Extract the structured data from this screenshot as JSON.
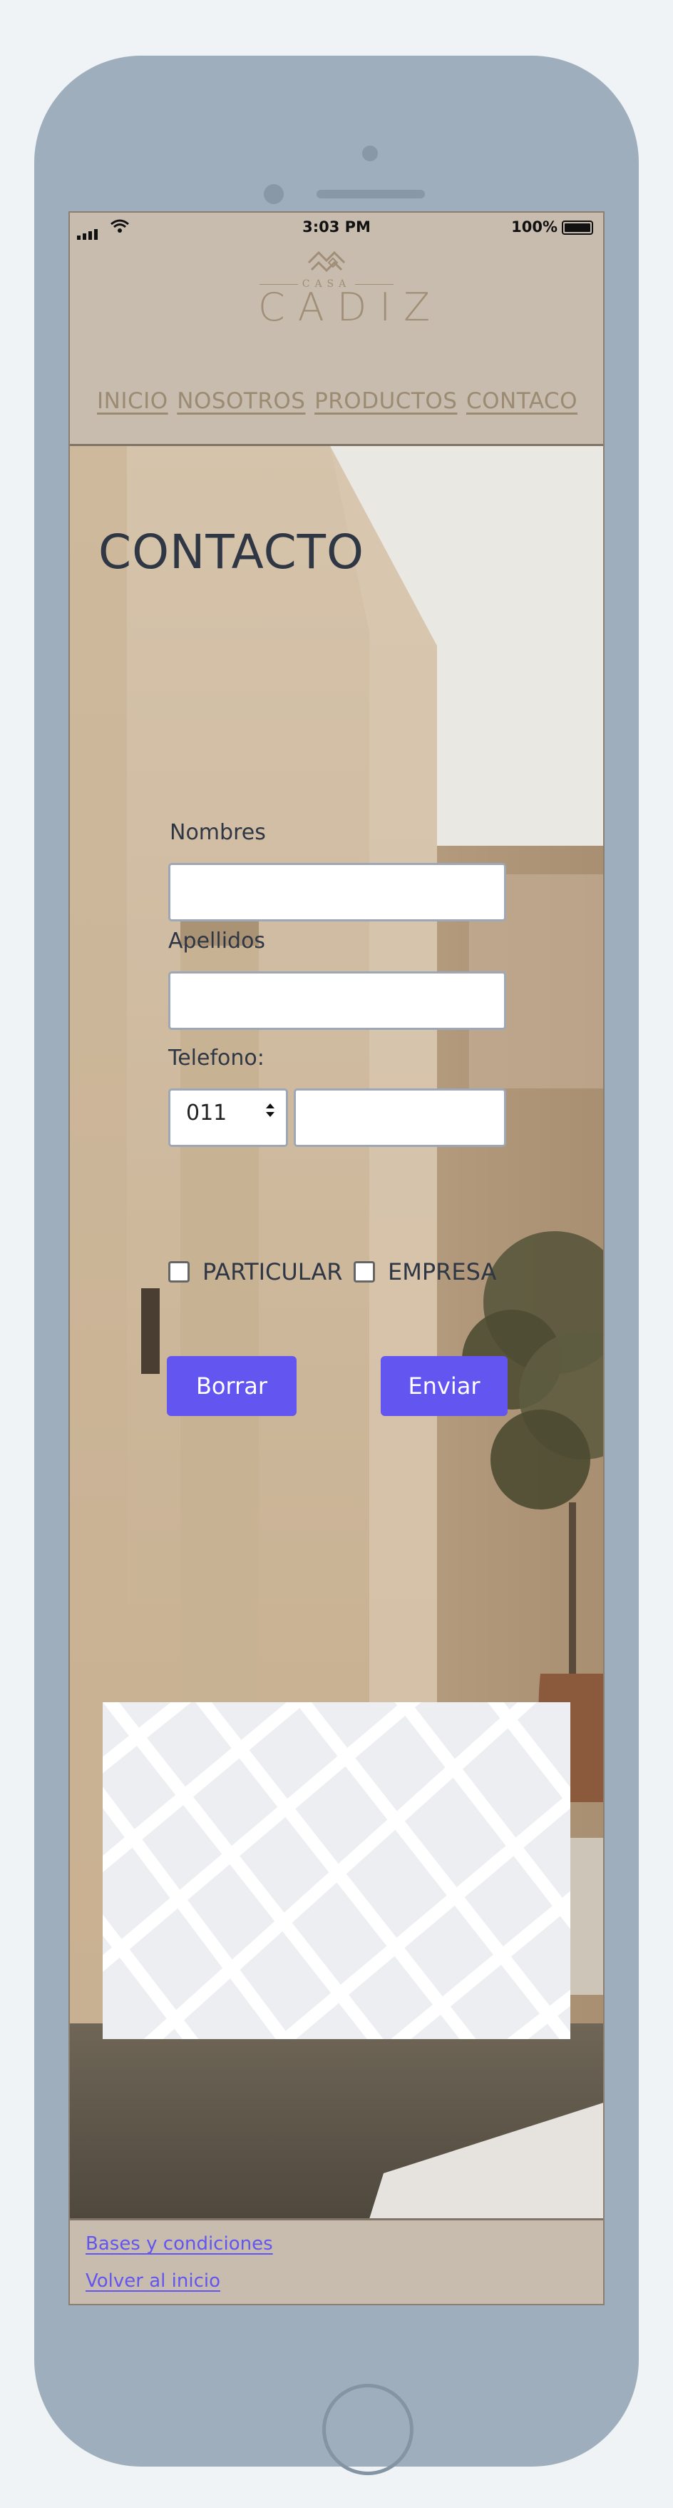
{
  "status_bar": {
    "time": "3:03 PM",
    "battery": "100%"
  },
  "brand": {
    "small": "CASA",
    "big": "CADIZ"
  },
  "nav": {
    "items": [
      "INICIO",
      "NOSOTROS",
      "PRODUCTOS",
      "CONTACO"
    ]
  },
  "page": {
    "title": "CONTACTO"
  },
  "form": {
    "first_name_label": "Nombres",
    "first_name_value": "",
    "last_name_label": "Apellidos",
    "last_name_value": "",
    "phone_label": "Telefono:",
    "area_code": "011",
    "phone_value": "",
    "checkbox_particular": "PARTICULAR",
    "checkbox_empresa": "EMPRESA",
    "reset_button": "Borrar",
    "submit_button": "Enviar"
  },
  "footer": {
    "terms_link": "Bases y condiciones",
    "home_link": "Volver al inicio"
  },
  "colors": {
    "accent": "#6356f0",
    "header_bg": "#c7bcae",
    "text": "#2f3644",
    "nav_text": "#9c8b73",
    "device": "#9eaebc"
  }
}
